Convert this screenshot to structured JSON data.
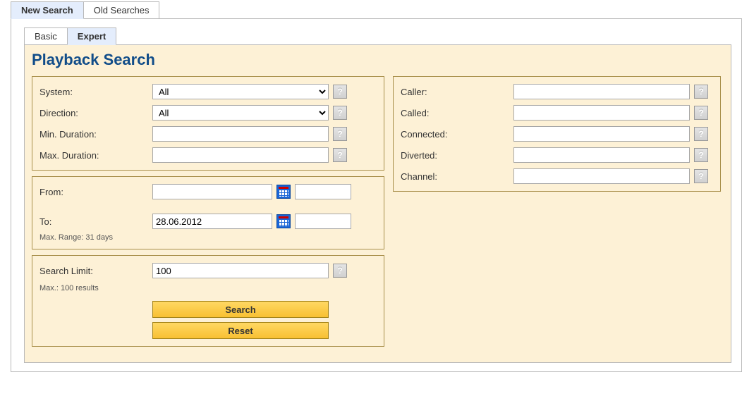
{
  "outer_tabs": {
    "new_search": "New Search",
    "old_searches": "Old Searches"
  },
  "inner_tabs": {
    "basic": "Basic",
    "expert": "Expert"
  },
  "page_title": "Playback Search",
  "help_symbol": "?",
  "left_box": {
    "system": {
      "label": "System:",
      "value": "All"
    },
    "direction": {
      "label": "Direction:",
      "value": "All"
    },
    "min_duration": {
      "label": "Min. Duration:",
      "value": ""
    },
    "max_duration": {
      "label": "Max. Duration:",
      "value": ""
    }
  },
  "date_box": {
    "from": {
      "label": "From:",
      "date": "",
      "time": ""
    },
    "to": {
      "label": "To:",
      "date": "28.06.2012",
      "time": ""
    },
    "range_note": "Max. Range: 31 days"
  },
  "limit_box": {
    "label": "Search Limit:",
    "value": "100",
    "note": "Max.: 100 results",
    "search_btn": "Search",
    "reset_btn": "Reset"
  },
  "right_box": {
    "caller": {
      "label": "Caller:",
      "value": ""
    },
    "called": {
      "label": "Called:",
      "value": ""
    },
    "connected": {
      "label": "Connected:",
      "value": ""
    },
    "diverted": {
      "label": "Diverted:",
      "value": ""
    },
    "channel": {
      "label": "Channel:",
      "value": ""
    }
  }
}
